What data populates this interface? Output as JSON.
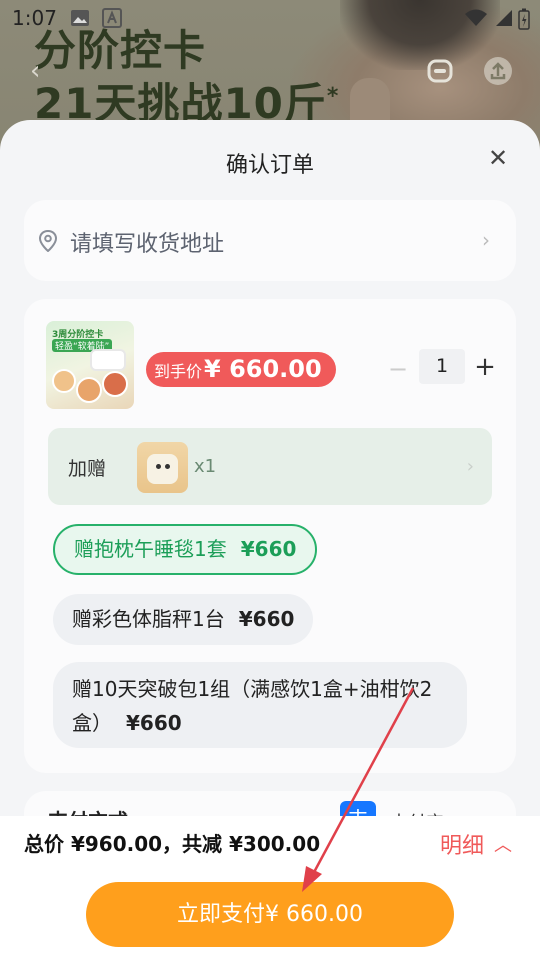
{
  "status_bar": {
    "time": "1:07"
  },
  "background": {
    "promo_line1": "分阶控卡",
    "promo_line2": "21天挑战10斤",
    "promo_mark": "*"
  },
  "sheet": {
    "title": "确认订单",
    "address_placeholder": "请填写收货地址",
    "product": {
      "thumb_line1": "3周分阶控卡",
      "thumb_line2": "轻盈“软着陆”",
      "price_label": "到手价",
      "price_value": "¥ 660.00",
      "quantity": "1"
    },
    "gift": {
      "label": "加赠",
      "count": "x1"
    },
    "options": [
      {
        "label": "赠抱枕午睡毯1套",
        "amount": "¥660",
        "selected": true
      },
      {
        "label": "赠彩色体脂秤1台",
        "amount": "¥660",
        "selected": false
      },
      {
        "label": "赠10天突破包1组（满感饮1盒+油柑饮2盒）",
        "amount": "¥660",
        "selected": false
      }
    ],
    "payment": {
      "label": "支付方式",
      "method_icon": "支",
      "method_name": "支付宝"
    }
  },
  "footer": {
    "total_text": "总价 ¥960.00，共减 ¥300.00",
    "detail_label": "明细",
    "pay_button": "立即支付¥ 660.00"
  },
  "colors": {
    "accent_red": "#f05a5a",
    "pay_orange": "#ff9f1c",
    "selected_green": "#27b16a",
    "annotation_arrow": "#e0404a"
  }
}
